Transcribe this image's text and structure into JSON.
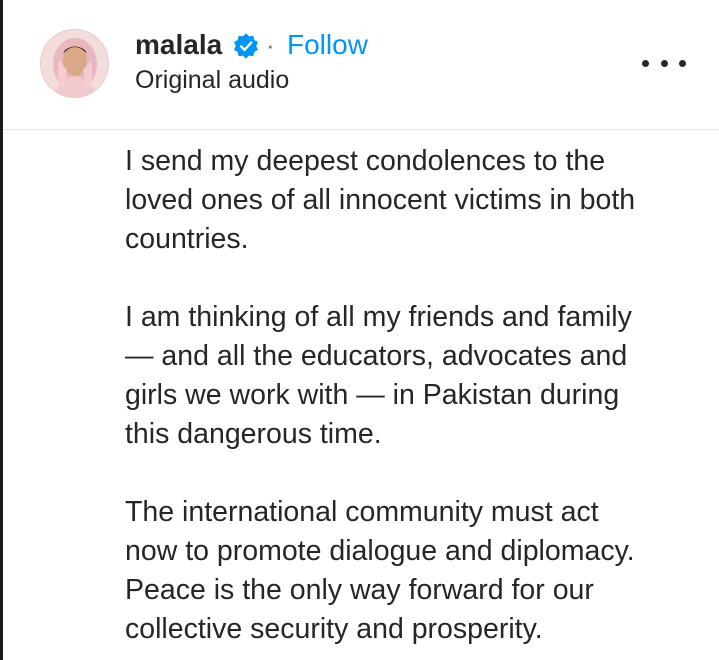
{
  "post_header": {
    "username": "malala",
    "follow_label": "Follow",
    "separator": "·",
    "subtitle": "Original audio",
    "verified_icon": "verified-badge-icon",
    "more_icon": "more-options-icon"
  },
  "colors": {
    "link_blue": "#0095f6",
    "verified_blue": "#0095f6",
    "text": "#262626",
    "divider": "#e4e4e4"
  },
  "caption": {
    "paragraphs": [
      [
        "I send my deepest condolences to the",
        "loved ones of all innocent victims in both",
        "countries."
      ],
      [
        "I am thinking of all my friends and family",
        "— and all the educators, advocates and",
        "girls we work with — in Pakistan during",
        "this dangerous time."
      ],
      [
        "The international community must act",
        "now to promote dialogue and diplomacy.",
        "Peace is the only way forward for our",
        "collective security and prosperity."
      ]
    ]
  }
}
